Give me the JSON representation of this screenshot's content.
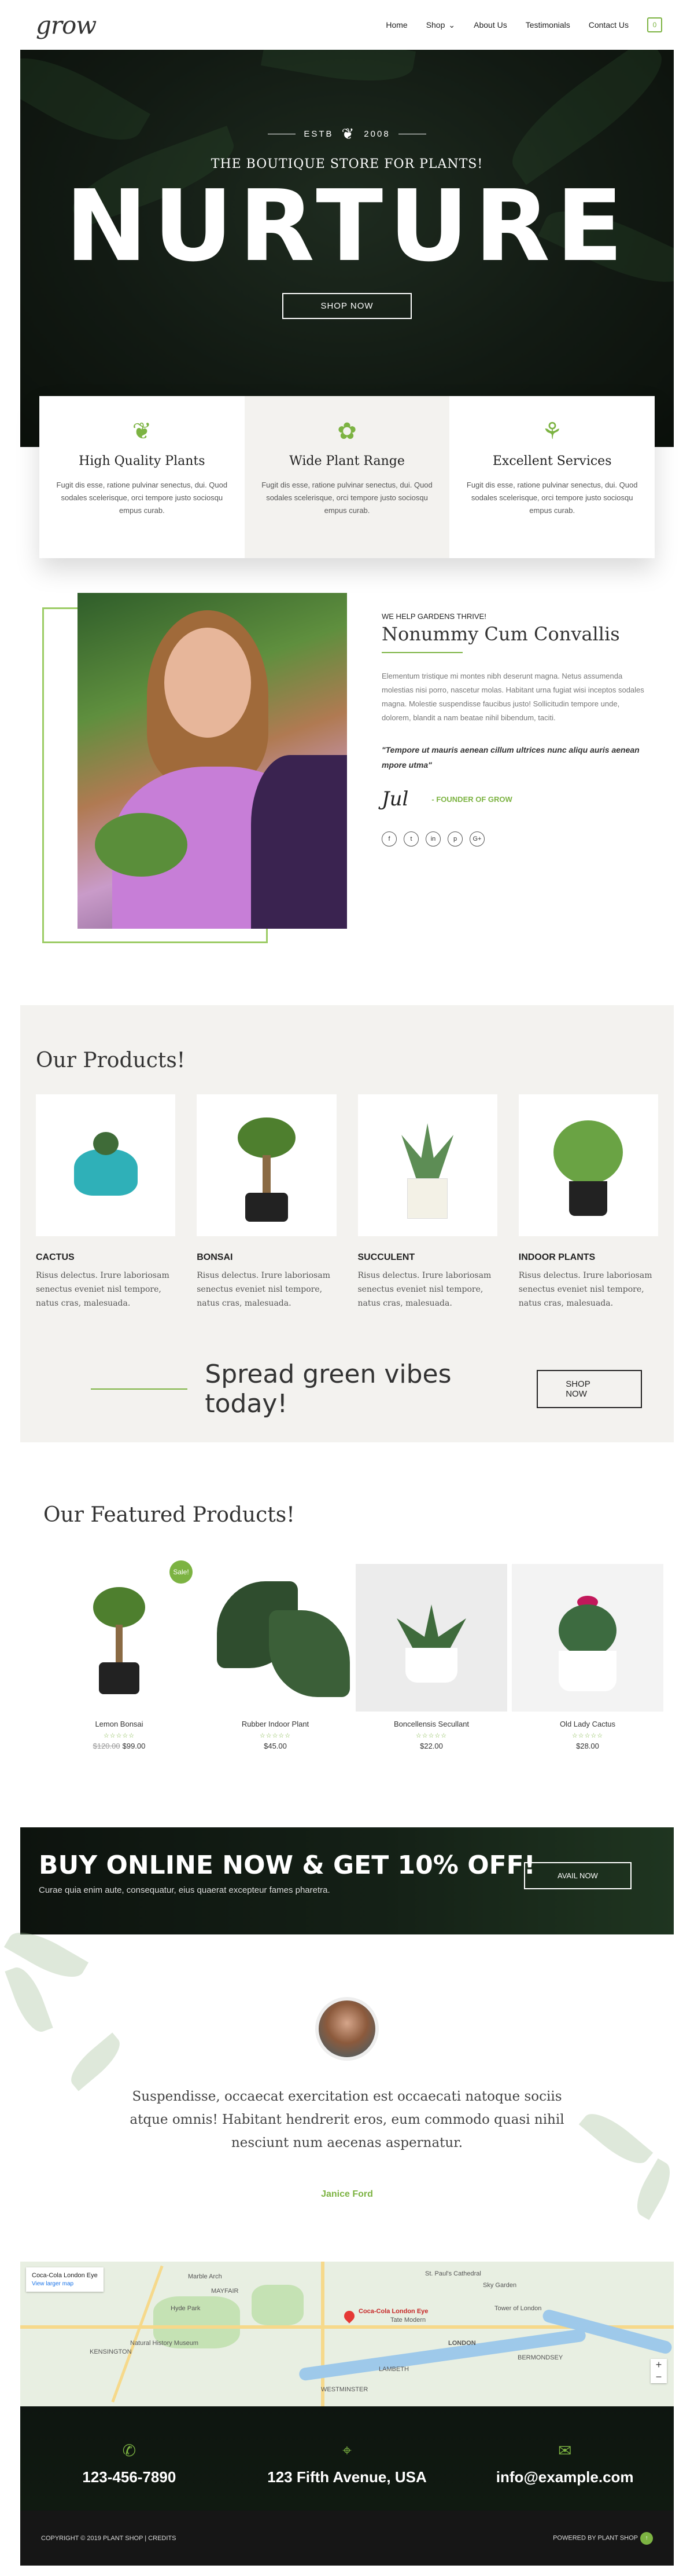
{
  "header": {
    "logo": "grow",
    "nav": [
      {
        "label": "Home"
      },
      {
        "label": "Shop",
        "chevron": "⌄"
      },
      {
        "label": "About Us"
      },
      {
        "label": "Testimonials"
      },
      {
        "label": "Contact Us"
      }
    ],
    "cart_count": "0"
  },
  "hero": {
    "estb_left": "ESTB",
    "estb_right": "2008",
    "subtitle": "THE BOUTIQUE STORE FOR PLANTS!",
    "title": "NURTURE",
    "button": "SHOP NOW"
  },
  "features": [
    {
      "icon": "❦",
      "icon_name": "leaf-icon",
      "title": "High Quality Plants",
      "text": "Fugit dis esse, ratione pulvinar senectus, dui. Quod sodales scelerisque, orci tempore justo sociosqu empus curab."
    },
    {
      "icon": "✿",
      "icon_name": "potted-plant-icon",
      "title": "Wide Plant Range",
      "text": "Fugit dis esse, ratione pulvinar senectus, dui. Quod sodales scelerisque, orci tempore justo sociosqu empus curab."
    },
    {
      "icon": "⚘",
      "icon_name": "watering-can-icon",
      "title": "Excellent Services",
      "text": "Fugit dis esse, ratione pulvinar senectus, dui. Quod sodales scelerisque, orci tempore justo sociosqu empus curab."
    }
  ],
  "about": {
    "eyebrow": "WE HELP GARDENS THRIVE!",
    "title": "Nonummy Cum Convallis",
    "body": "Elementum tristique mi montes nibh deserunt magna. Netus assumenda molestias nisi porro, nascetur molas. Habitant urna fugiat wisi inceptos sodales magna. Molestie suspendisse faucibus justo! Sollicitudin tempore unde, dolorem, blandit a nam beatae nihil bibendum, taciti.",
    "quote": "\"Tempore ut mauris aenean cillum ultrices nunc aliqu auris aenean mpore utma\"",
    "signature": "Jul",
    "founder": "- FOUNDER OF GROW",
    "socials": [
      "f",
      "t",
      "in",
      "p",
      "G+"
    ]
  },
  "products": {
    "heading": "Our Products!",
    "items": [
      {
        "name": "CACTUS",
        "text": "Risus delectus. Irure laboriosam senectus eveniet nisl tempore, natus cras, malesuada."
      },
      {
        "name": "BONSAI",
        "text": "Risus delectus. Irure laboriosam senectus eveniet nisl tempore, natus cras, malesuada."
      },
      {
        "name": "SUCCULENT",
        "text": "Risus delectus. Irure laboriosam senectus eveniet nisl tempore, natus cras, malesuada."
      },
      {
        "name": "INDOOR PLANTS",
        "text": "Risus delectus. Irure laboriosam senectus eveniet nisl tempore, natus cras, malesuada."
      }
    ],
    "cta_text": "Spread green vibes today!",
    "cta_button": "SHOP NOW"
  },
  "featured": {
    "heading": "Our Featured Products!",
    "sale_badge": "Sale!",
    "items": [
      {
        "name": "Lemon Bonsai",
        "stars": "☆☆☆☆☆",
        "old_price": "$120.00",
        "price": "$99.00"
      },
      {
        "name": "Rubber Indoor Plant",
        "stars": "☆☆☆☆☆",
        "old_price": "",
        "price": "$45.00"
      },
      {
        "name": "Boncellensis Secullant",
        "stars": "☆☆☆☆☆",
        "old_price": "",
        "price": "$22.00"
      },
      {
        "name": "Old Lady Cactus",
        "stars": "☆☆☆☆☆",
        "old_price": "",
        "price": "$28.00"
      }
    ]
  },
  "banner": {
    "title": "BUY ONLINE NOW & GET 10% OFF!",
    "text": "Curae quia enim aute, consequatur, eius quaerat excepteur fames pharetra.",
    "button": "AVAIL NOW"
  },
  "testimonial": {
    "quote": "Suspendisse, occaecat exercitation est occaecati natoque sociis atque omnis! Habitant hendrerit eros, eum commodo quasi nihil nesciunt num aecenas aspernatur.",
    "name": "Janice Ford"
  },
  "map": {
    "place": "Coca-Cola London Eye",
    "link": "View larger map",
    "pin_label": "Coca-Cola London Eye",
    "labels": [
      "Marble Arch",
      "MAYFAIR",
      "Hyde Park",
      "KENSINGTON",
      "WESTMINSTER",
      "LAMBETH",
      "St. Paul's Cathedral",
      "Sky Garden",
      "Tower of London",
      "BERMONDSEY",
      "Natural History Museum",
      "Tate Modern",
      "LONDON"
    ],
    "zoom_in": "+",
    "zoom_out": "−"
  },
  "contact": {
    "phone_icon": "✆",
    "phone": "123-456-7890",
    "address_icon": "⌖",
    "address": "123 Fifth Avenue, USA",
    "email_icon": "✉",
    "email": "info@example.com"
  },
  "footer": {
    "copyright": "COPYRIGHT © 2019 PLANT SHOP | CREDITS",
    "powered": "POWERED BY PLANT SHOP",
    "up_icon": "↑"
  },
  "colors": {
    "accent": "#7cb342",
    "dark": "#121a13",
    "light_bg": "#f3f2ef"
  }
}
